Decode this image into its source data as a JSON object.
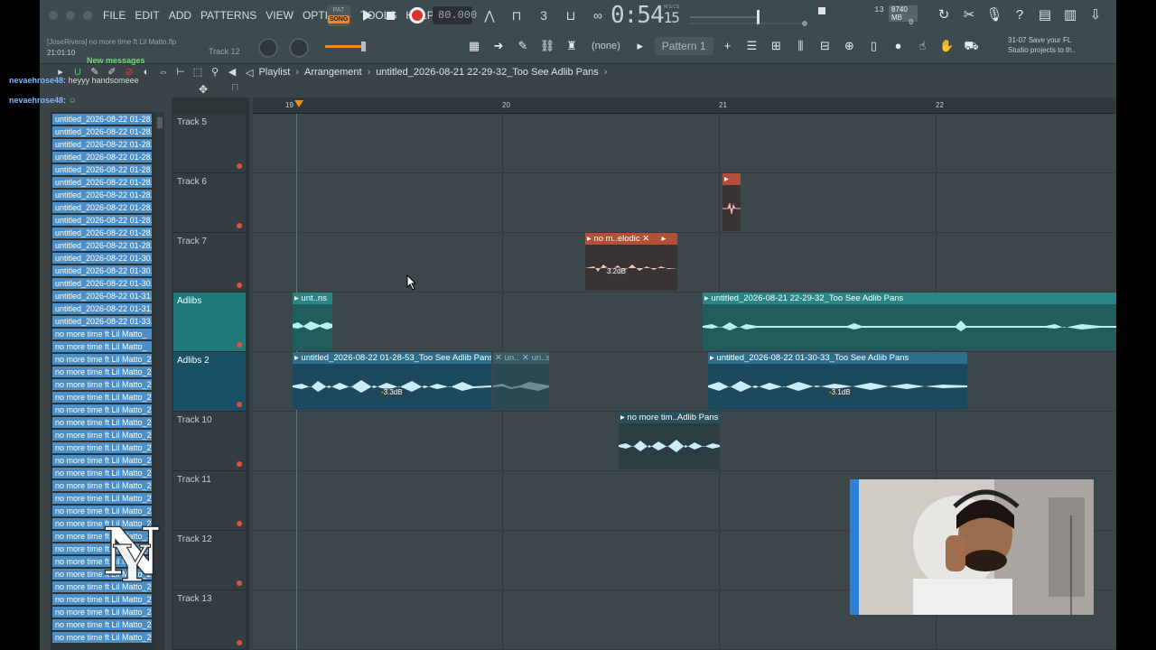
{
  "menu": {
    "items": [
      "FILE",
      "EDIT",
      "ADD",
      "PATTERNS",
      "VIEW",
      "OPTIONS",
      "TOOLS",
      "HELP"
    ]
  },
  "transport": {
    "pat_label": "PAT",
    "song_label": "SONG",
    "tempo": "80.000",
    "time_main": "0:54",
    "time_frac": "15",
    "time_unit": "M:S:CS",
    "cpu_value": "13",
    "mem_value": "8740 MB",
    "poly_value": "0"
  },
  "hint": {
    "line1": "[JoseRivera] no more time ft Lil Matto.flp",
    "line2": "21:01:10",
    "track": "Track 12"
  },
  "toolbar2": {
    "none_label": "(none)",
    "pattern_label": "Pattern 1",
    "news_time": "31-07",
    "news_text": "Save your FL Studio projects to th.."
  },
  "chat": {
    "new_messages": "New messages",
    "user1": "nevaehrose48:",
    "msg1": "heyyy handsomeee",
    "user2": "nevaehrose48:"
  },
  "playlist": {
    "title": "Playlist",
    "section": "Arrangement",
    "file": "untitled_2026-08-21 22-29-32_Too See Adlib Pans"
  },
  "browser": {
    "items": [
      "untitled_2026-08-22 01-28...",
      "untitled_2026-08-22 01-28...",
      "untitled_2026-08-22 01-28...",
      "untitled_2026-08-22 01-28...",
      "untitled_2026-08-22 01-28...",
      "untitled_2026-08-22 01-28...",
      "untitled_2026-08-22 01-28...",
      "untitled_2026-08-22 01-28...",
      "untitled_2026-08-22 01-28...",
      "untitled_2026-08-22 01-28...",
      "untitled_2026-08-22 01-28...",
      "untitled_2026-08-22 01-30...",
      "untitled_2026-08-22 01-30...",
      "untitled_2026-08-22 01-30...",
      "untitled_2026-08-22 01-31...",
      "untitled_2026-08-22 01-31...",
      "untitled_2026-08-22 01-33...",
      "no more time ft Lil Matto_",
      "no more time ft Lil Matto_",
      "no more time ft Lil Matto_2...",
      "no more time ft Lil Matto_2...",
      "no more time ft Lil Matto_2...",
      "no more time ft Lil Matto_2...",
      "no more time ft Lil Matto_2...",
      "no more time ft Lil Matto_2...",
      "no more time ft Lil Matto_2...",
      "no more time ft Lil Matto_2...",
      "no more time ft Lil Matto_2...",
      "no more time ft Lil Matto_2...",
      "no more time ft Lil Matto_2...",
      "no more time ft Lil Matto_2...",
      "no more time ft Lil Matto_2...",
      "no more time ft Lil Matto_2...",
      "no more time ft Lil Matto_2...",
      "no more time ft Lil Matto_2...",
      "no more time ft Lil Matto_2...",
      "no more time ft Lil Matto_2...",
      "no more time ft Lil Matto_2...",
      "no more time ft Lil Matto_2...",
      "no more time ft Lil Matto_2...",
      "no more time ft Lil Matto_2...",
      "no more time ft Lil Matto_2..."
    ]
  },
  "ruler": {
    "marks": [
      "19",
      "20",
      "21",
      "22"
    ]
  },
  "tracks": [
    {
      "name": "Track 5"
    },
    {
      "name": "Track 6"
    },
    {
      "name": "Track 7"
    },
    {
      "name": "Adlibs"
    },
    {
      "name": "Adlibs 2"
    },
    {
      "name": "Track 10"
    },
    {
      "name": "Track 11"
    },
    {
      "name": "Track 12"
    },
    {
      "name": "Track 13"
    }
  ],
  "clips": {
    "t6_small": "",
    "t7_clip": "no m..elodic",
    "t7_db": "3.2dB",
    "adlibs_short": "unt..ns",
    "adlibs_long": "untitled_2026-08-21 22-29-32_Too See Adlib Pans",
    "adlibs2_a": "untitled_2026-08-22 01-28-53_Too See Adlib Pans",
    "adlibs2_a_db": "-3.3dB",
    "adlibs2_b": "un..",
    "adlibs2_c": "un..s",
    "adlibs2_d": "untitled_2026-08-22 01-30-33_Too See Adlib Pans",
    "adlibs2_d_db": "-3.1dB",
    "t10_clip": "no more tim..Adlib Pans"
  },
  "colors": {
    "accent_orange": "#f08a1e",
    "record_red": "#d8342c",
    "clip_teal": "#2a8587",
    "clip_blue": "#2d6f8c",
    "clip_orange": "#b24f36",
    "browser_item": "#4b8fc6",
    "webcam_border": "#2e7fd6"
  }
}
